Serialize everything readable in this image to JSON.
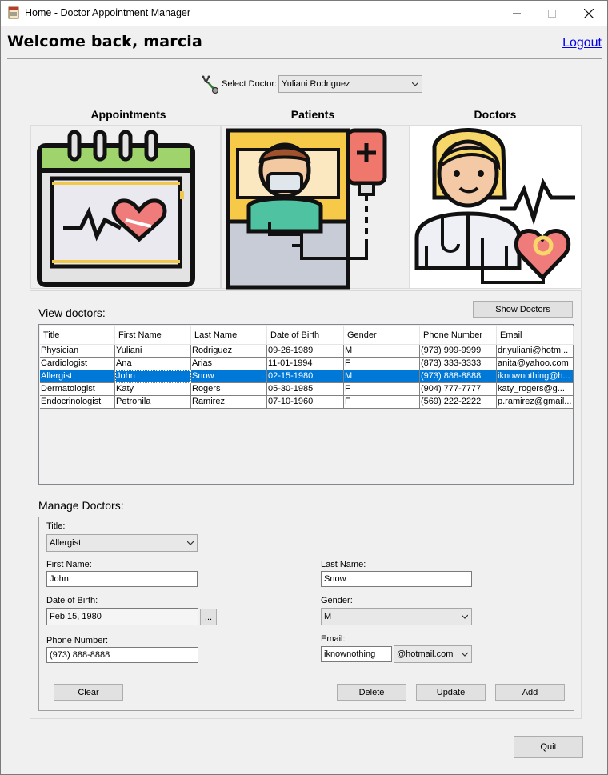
{
  "window": {
    "title": "Home - Doctor Appointment Manager",
    "controls": [
      "minimize-icon",
      "maximize-icon",
      "close-icon"
    ]
  },
  "header": {
    "welcome": "Welcome back, marcia",
    "logout": "Logout"
  },
  "doctor_select": {
    "label": "Select Doctor:",
    "value": "Yuliani Rodriguez"
  },
  "sections": {
    "appointments": "Appointments",
    "patients": "Patients",
    "doctors": "Doctors"
  },
  "view": {
    "label": "View doctors:",
    "show_button": "Show Doctors"
  },
  "table": {
    "columns": [
      "Title",
      "First Name",
      "Last Name",
      "Date of Birth",
      "Gender",
      "Phone Number",
      "Email"
    ],
    "rows": [
      [
        "Physician",
        "Yuliani",
        "Rodriguez",
        "09-26-1989",
        "M",
        "(973) 999-9999",
        "dr.yuliani@hotm..."
      ],
      [
        "Cardiologist",
        "Ana",
        "Arias",
        "11-01-1994",
        "F",
        "(873) 333-3333",
        "anita@yahoo.com"
      ],
      [
        "Allergist",
        "John",
        "Snow",
        "02-15-1980",
        "M",
        "(973) 888-8888",
        "iknownothing@h..."
      ],
      [
        "Dermatologist",
        "Katy",
        "Rogers",
        "05-30-1985",
        "F",
        "(904) 777-7777",
        "katy_rogers@g..."
      ],
      [
        "Endocrinologist",
        "Petronila",
        "Ramirez",
        "07-10-1960",
        "F",
        "(569) 222-2222",
        "p.ramirez@gmail..."
      ]
    ],
    "selected_row": 2
  },
  "manage": {
    "label": "Manage Doctors:",
    "title_label": "Title:",
    "title_value": "Allergist",
    "first_name_label": "First Name:",
    "first_name_value": "John",
    "last_name_label": "Last Name:",
    "last_name_value": "Snow",
    "dob_label": "Date of Birth:",
    "dob_value": "Feb 15, 1980",
    "dob_button": "...",
    "gender_label": "Gender:",
    "gender_value": "M",
    "phone_label": "Phone Number:",
    "phone_value": "(973) 888-8888",
    "email_label": "Email:",
    "email_user": "iknownothing",
    "email_domain": "@hotmail.com",
    "clear": "Clear",
    "delete": "Delete",
    "update": "Update",
    "add": "Add"
  },
  "quit": "Quit",
  "colors": {
    "selection": "#0078d7",
    "link": "#0000ee",
    "window_bg": "#f0f0f0"
  }
}
